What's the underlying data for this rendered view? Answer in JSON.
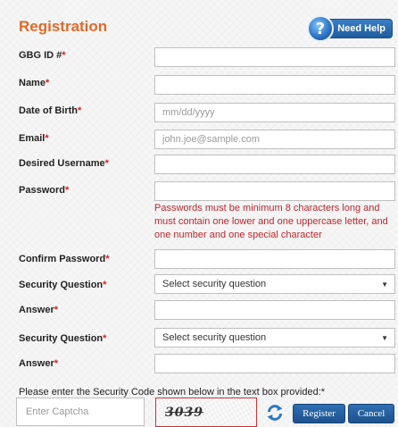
{
  "header": {
    "title": "Registration",
    "help_label": "Need Help",
    "help_icon": "?"
  },
  "form": {
    "gbg_id": {
      "label": "GBG ID #",
      "req": "*",
      "value": ""
    },
    "name": {
      "label": "Name",
      "req": "*",
      "value": ""
    },
    "dob": {
      "label": "Date of Birth",
      "req": "*",
      "placeholder": "mm/dd/yyyy"
    },
    "email": {
      "label": "Email",
      "req": "*",
      "placeholder": "john.joe@sample.com"
    },
    "username": {
      "label": "Desired Username",
      "req": "*",
      "value": ""
    },
    "password": {
      "label": "Password",
      "req": "*",
      "value": ""
    },
    "password_hint": "Passwords must be minimum 8 characters long and must contain one lower and one uppercase letter, and one number and one special character",
    "confirm_password": {
      "label": "Confirm Password",
      "req": "*",
      "value": ""
    },
    "security_question_1": {
      "label": "Security Question",
      "req": "*",
      "selected": "Select security question"
    },
    "answer_1": {
      "label": "Answer",
      "req": "*",
      "value": ""
    },
    "security_question_2": {
      "label": "Security Question",
      "req": "*",
      "selected": "Select security question"
    },
    "answer_2": {
      "label": "Answer",
      "req": "*",
      "value": ""
    }
  },
  "captcha": {
    "note": "Please enter the Security Code shown below in the text box provided:*",
    "placeholder": "Enter Captcha",
    "code": "3039"
  },
  "actions": {
    "register_label": "Register",
    "cancel_label": "Cancel"
  },
  "colors": {
    "title": "#e0692a",
    "required": "#d62020",
    "hint": "#c0262c",
    "button": "#1d528e"
  },
  "icons": {
    "help": "help-icon",
    "refresh": "refresh-icon",
    "dropdown": "chevron-down-icon"
  }
}
